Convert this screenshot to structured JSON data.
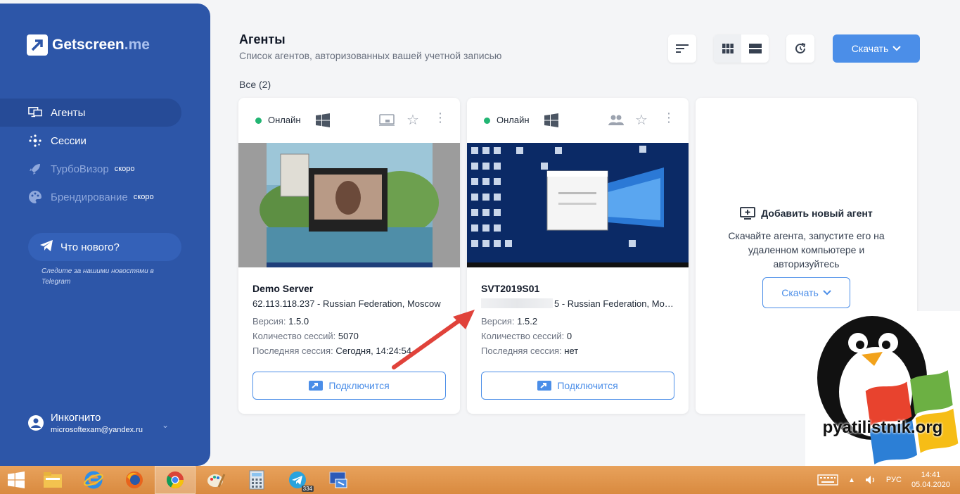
{
  "brand": {
    "name": "Getscreen",
    "suffix": ".me"
  },
  "sidebar": {
    "items": [
      {
        "label": "Агенты",
        "icon": "monitor-icon",
        "active": true
      },
      {
        "label": "Сессии",
        "icon": "network-icon"
      },
      {
        "label": "ТурбоВизор",
        "icon": "rocket-icon",
        "badge": "скоро"
      },
      {
        "label": "Брендирование",
        "icon": "palette-icon",
        "badge": "скоро"
      }
    ],
    "news": {
      "label": "Что нового?",
      "subtitle": "Следите за нашими новостями в Telegram"
    },
    "user": {
      "name": "Инкогнито",
      "email": "microsoftexam@yandex.ru"
    }
  },
  "header": {
    "title": "Агенты",
    "subtitle": "Список агентов, авторизованных вашей учетной записью",
    "filter": "Все (2)",
    "download_label": "Скачать"
  },
  "agents": [
    {
      "status": "Онлайн",
      "name": "Demo Server",
      "address": "62.113.118.237 - Russian Federation, Moscow",
      "version_label": "Версия:",
      "version": "1.5.0",
      "sessions_label": "Количество сессий:",
      "sessions": "5070",
      "last_label": "Последняя сессия:",
      "last": "Сегодня, 14:24:54",
      "connect_label": "Подключится"
    },
    {
      "status": "Онлайн",
      "name": "SVT2019S01",
      "address_tail": "5 - Russian Federation, Mosc...",
      "version_label": "Версия:",
      "version": "1.5.2",
      "sessions_label": "Количество сессий:",
      "sessions": "0",
      "last_label": "Последняя сессия:",
      "last": "нет",
      "connect_label": "Подключится"
    }
  ],
  "add_agent": {
    "title": "Добавить новый агент",
    "description": "Скачайте агента, запустите его на удаленном компьютере и авторизуйтесь",
    "download_label": "Скачать"
  },
  "watermark": {
    "text": "pyatilistnik.org"
  },
  "taskbar": {
    "apps": [
      "windows-start-icon",
      "file-explorer-icon",
      "internet-explorer-icon",
      "firefox-icon",
      "chrome-icon",
      "paint-icon",
      "calculator-icon",
      "telegram-icon",
      "remote-desktop-icon"
    ],
    "telegram_count": "334",
    "lang": "РУС",
    "time": "14:41",
    "date": "05.04.2020"
  },
  "colors": {
    "sidebar": "#2d56a8",
    "accent": "#4b8ee8",
    "online": "#22b573",
    "taskbar": "#d98a3f"
  }
}
